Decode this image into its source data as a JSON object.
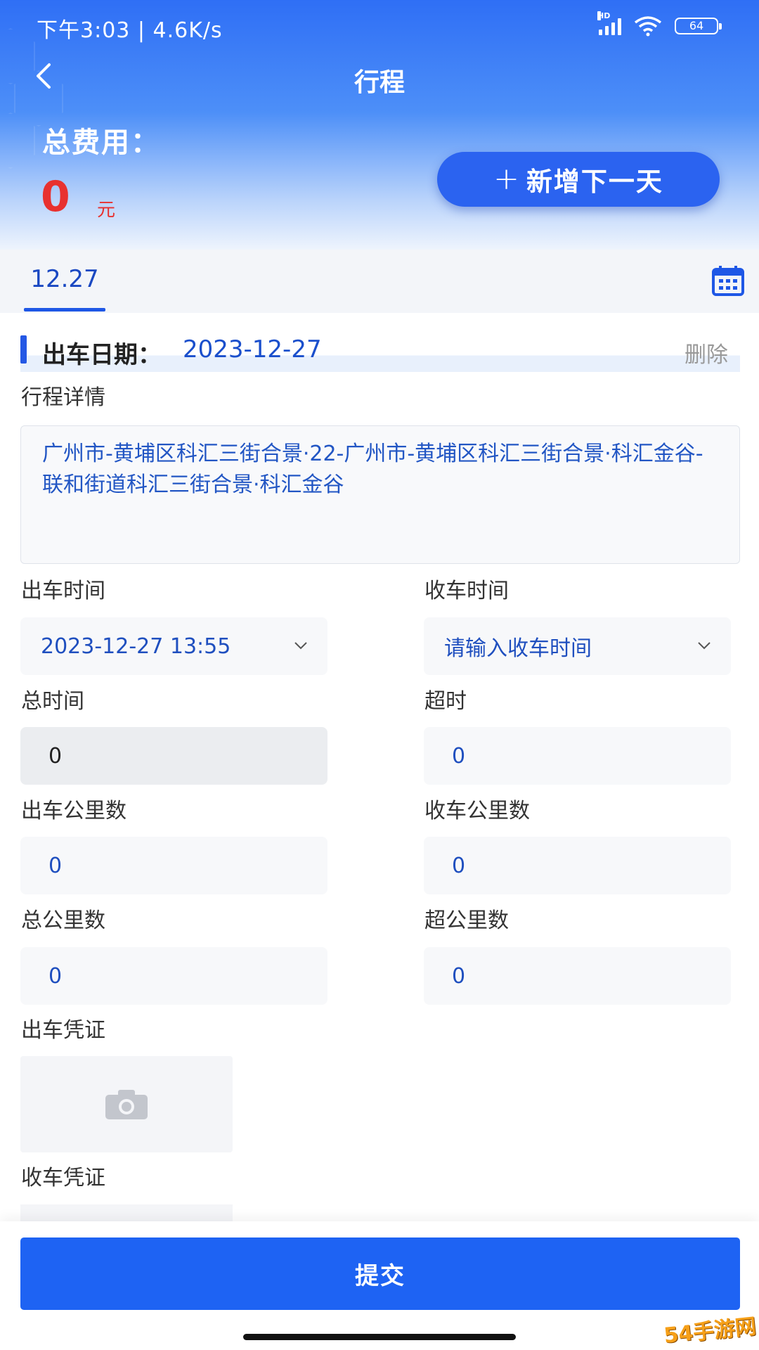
{
  "status_bar": {
    "time": "下午3:03 | 4.6K/s",
    "hd": "HD",
    "battery": "64"
  },
  "nav": {
    "title": "行程"
  },
  "summary": {
    "label": "总费用：",
    "value": "0",
    "unit": "元",
    "add_button": "新增下一天"
  },
  "tabs": [
    {
      "label": "12.27",
      "active": true
    }
  ],
  "section": {
    "title": "出车日期：",
    "date": "2023-12-27",
    "delete": "删除"
  },
  "trip": {
    "detail_label": "行程详情",
    "detail_text": "广州市-黄埔区科汇三街合景·22-广州市-黄埔区科汇三街合景·科汇金谷-联和街道科汇三街合景·科汇金谷"
  },
  "fields": {
    "depart_time": {
      "label": "出车时间",
      "value": "2023-12-27 13:55"
    },
    "return_time": {
      "label": "收车时间",
      "placeholder": "请输入收车时间"
    },
    "total_time": {
      "label": "总时间",
      "value": "0"
    },
    "overtime": {
      "label": "超时",
      "value": "0"
    },
    "depart_km": {
      "label": "出车公里数",
      "value": "0"
    },
    "return_km": {
      "label": "收车公里数",
      "value": "0"
    },
    "total_km": {
      "label": "总公里数",
      "value": "0"
    },
    "over_km": {
      "label": "超公里数",
      "value": "0"
    }
  },
  "vouchers": {
    "depart_label": "出车凭证",
    "return_label": "收车凭证"
  },
  "footer": {
    "submit": "提交"
  },
  "watermark": "54手游网",
  "colors": {
    "primary": "#1e63f3",
    "accent_red": "#e8312f",
    "link_blue": "#1a4fcc"
  }
}
